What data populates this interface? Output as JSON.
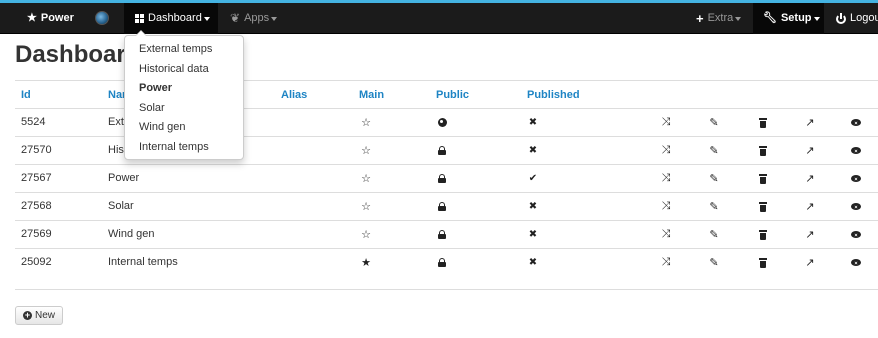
{
  "navbar": {
    "brand": "Power",
    "brand_icon": "star-icon",
    "dashboard_label": "Dashboard",
    "apps_label": "Apps",
    "extra_label": "Extra",
    "setup_label": "Setup",
    "logout_label": "Logout",
    "colors": {
      "bar": "#1b1b1b",
      "accent_line": "#44b3e2"
    }
  },
  "dashboard_menu": {
    "items": [
      "External temps",
      "Historical data",
      "Power",
      "Solar",
      "Wind gen",
      "Internal temps"
    ],
    "active": "Power"
  },
  "page": {
    "title": "Dashboards"
  },
  "table": {
    "headers": {
      "id": "Id",
      "name": "Name",
      "alias": "Alias",
      "main": "Main",
      "public": "Public",
      "published": "Published"
    },
    "header_color": "#1e84c4",
    "rows": [
      {
        "id": "5524",
        "name": "External temps",
        "main": "star-outline-icon",
        "public": "globe-icon",
        "published": "cross-icon"
      },
      {
        "id": "27570",
        "name": "Historical data",
        "main": "star-outline-icon",
        "public": "lock-icon",
        "published": "cross-icon"
      },
      {
        "id": "27567",
        "name": "Power",
        "main": "star-outline-icon",
        "public": "lock-icon",
        "published": "check-icon"
      },
      {
        "id": "27568",
        "name": "Solar",
        "main": "star-outline-icon",
        "public": "lock-icon",
        "published": "cross-icon"
      },
      {
        "id": "27569",
        "name": "Wind gen",
        "main": "star-outline-icon",
        "public": "lock-icon",
        "published": "cross-icon"
      },
      {
        "id": "25092",
        "name": "Internal temps",
        "main": "star-filled-icon",
        "public": "lock-icon",
        "published": "cross-icon"
      }
    ],
    "row_actions": [
      "shuffle-icon",
      "pencil-icon",
      "trash-icon",
      "share-icon",
      "eye-icon"
    ]
  },
  "new_button": {
    "label": "New"
  }
}
